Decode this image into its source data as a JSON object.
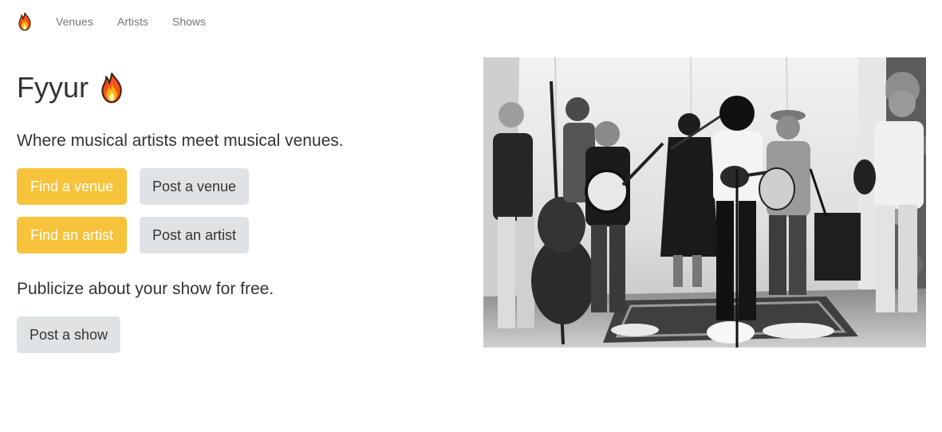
{
  "nav": {
    "brand_icon": "flame-icon",
    "links": [
      "Venues",
      "Artists",
      "Shows"
    ]
  },
  "hero": {
    "title": "Fyyur",
    "title_icon": "flame-icon",
    "tagline": "Where musical artists meet musical venues.",
    "buttons": {
      "find_venue": "Find a venue",
      "post_venue": "Post a venue",
      "find_artist": "Find an artist",
      "post_artist": "Post an artist",
      "post_show": "Post a show"
    },
    "publicize": "Publicize about your show for free."
  },
  "colors": {
    "primary": "#f7c33a",
    "secondary": "#e0e3e6",
    "text": "#333333",
    "nav_text": "#777777"
  }
}
